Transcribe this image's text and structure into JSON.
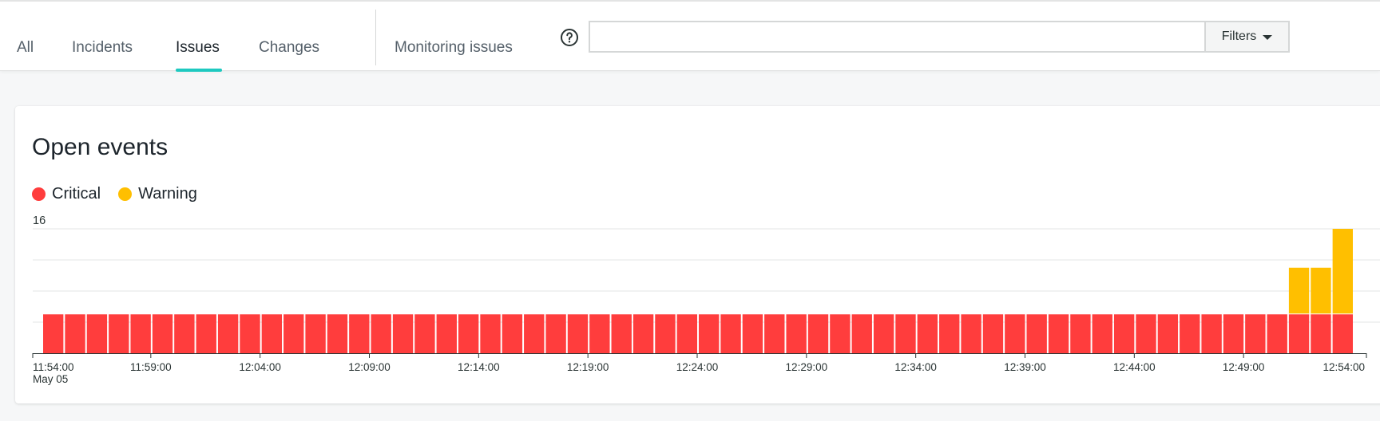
{
  "nav": {
    "tabs": [
      {
        "label": "All"
      },
      {
        "label": "Incidents"
      },
      {
        "label": "Issues",
        "active": true
      },
      {
        "label": "Changes"
      }
    ],
    "monitoring_label": "Monitoring issues",
    "help_icon": "question-circle-icon",
    "search": {
      "value": "",
      "placeholder": ""
    },
    "filters_label": "Filters",
    "accent_color": "#1ec9c0"
  },
  "card": {
    "title": "Open events"
  },
  "chart_data": {
    "type": "bar",
    "stacked": true,
    "title": "Open events",
    "legend": [
      {
        "name": "Critical",
        "color": "#ff3d3d"
      },
      {
        "name": "Warning",
        "color": "#ffbf00"
      }
    ],
    "legend_placement": "top-left",
    "ylim": [
      0,
      16
    ],
    "y_ticks_shown": [
      "16"
    ],
    "grid": true,
    "x_tick_labels": [
      "11:54:00",
      "11:59:00",
      "12:04:00",
      "12:09:00",
      "12:14:00",
      "12:19:00",
      "12:24:00",
      "12:29:00",
      "12:34:00",
      "12:39:00",
      "12:44:00",
      "12:49:00",
      "12:54:00"
    ],
    "x_date_label": "May 05",
    "bar_count": 60,
    "series": [
      {
        "name": "Critical",
        "values": [
          5,
          5,
          5,
          5,
          5,
          5,
          5,
          5,
          5,
          5,
          5,
          5,
          5,
          5,
          5,
          5,
          5,
          5,
          5,
          5,
          5,
          5,
          5,
          5,
          5,
          5,
          5,
          5,
          5,
          5,
          5,
          5,
          5,
          5,
          5,
          5,
          5,
          5,
          5,
          5,
          5,
          5,
          5,
          5,
          5,
          5,
          5,
          5,
          5,
          5,
          5,
          5,
          5,
          5,
          5,
          5,
          5,
          5,
          5,
          5
        ]
      },
      {
        "name": "Warning",
        "values": [
          0,
          0,
          0,
          0,
          0,
          0,
          0,
          0,
          0,
          0,
          0,
          0,
          0,
          0,
          0,
          0,
          0,
          0,
          0,
          0,
          0,
          0,
          0,
          0,
          0,
          0,
          0,
          0,
          0,
          0,
          0,
          0,
          0,
          0,
          0,
          0,
          0,
          0,
          0,
          0,
          0,
          0,
          0,
          0,
          0,
          0,
          0,
          0,
          0,
          0,
          0,
          0,
          0,
          0,
          0,
          0,
          0,
          6,
          6,
          11
        ]
      }
    ]
  }
}
